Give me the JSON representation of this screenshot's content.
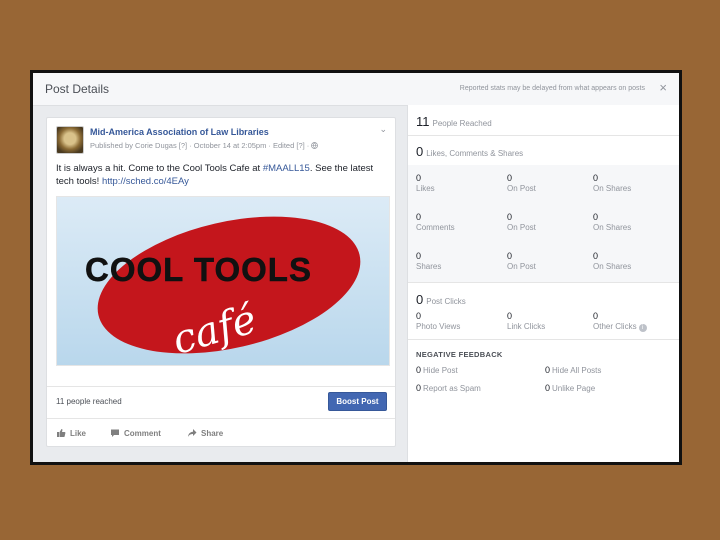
{
  "header": {
    "title": "Post Details",
    "note": "Reported stats may be delayed from what appears on posts",
    "close": "×"
  },
  "post": {
    "page_name": "Mid-America Association of Law Libraries",
    "meta": "Published by Corie Dugas [?] · October 14 at 2:05pm · Edited [?] ·",
    "text_before": "It is always a hit. Come to the Cool Tools Cafe at ",
    "hashtag": "#MAALL15",
    "text_middle": ". See the latest tech tools! ",
    "link": "http://sched.co/4EAy",
    "image_line1": "COOL TOOLS",
    "image_line2": "café",
    "reach": "11 people reached",
    "boost": "Boost Post",
    "actions": {
      "like": "Like",
      "comment": "Comment",
      "share": "Share"
    }
  },
  "stats": {
    "people_reached": {
      "value": "11",
      "label": "People Reached"
    },
    "engagement": {
      "value": "0",
      "label": "Likes, Comments & Shares"
    },
    "likes": [
      {
        "value": "0",
        "label": "Likes"
      },
      {
        "value": "0",
        "label": "On Post"
      },
      {
        "value": "0",
        "label": "On Shares"
      }
    ],
    "comments": [
      {
        "value": "0",
        "label": "Comments"
      },
      {
        "value": "0",
        "label": "On Post"
      },
      {
        "value": "0",
        "label": "On Shares"
      }
    ],
    "shares": [
      {
        "value": "0",
        "label": "Shares"
      },
      {
        "value": "0",
        "label": "On Post"
      },
      {
        "value": "0",
        "label": "On Shares"
      }
    ],
    "post_clicks": {
      "value": "0",
      "label": "Post Clicks"
    },
    "clicks": [
      {
        "value": "0",
        "label": "Photo Views"
      },
      {
        "value": "0",
        "label": "Link Clicks"
      },
      {
        "value": "0",
        "label": "Other Clicks"
      }
    ],
    "negative_feedback": {
      "title": "NEGATIVE FEEDBACK",
      "items": [
        {
          "value": "0",
          "label": "Hide Post"
        },
        {
          "value": "0",
          "label": "Hide All Posts"
        },
        {
          "value": "0",
          "label": "Report as Spam"
        },
        {
          "value": "0",
          "label": "Unlike Page"
        }
      ]
    }
  },
  "colors": {
    "background": "#986635",
    "link": "#365899",
    "boost": "#4267b2",
    "ellipse": "#c4161c"
  }
}
